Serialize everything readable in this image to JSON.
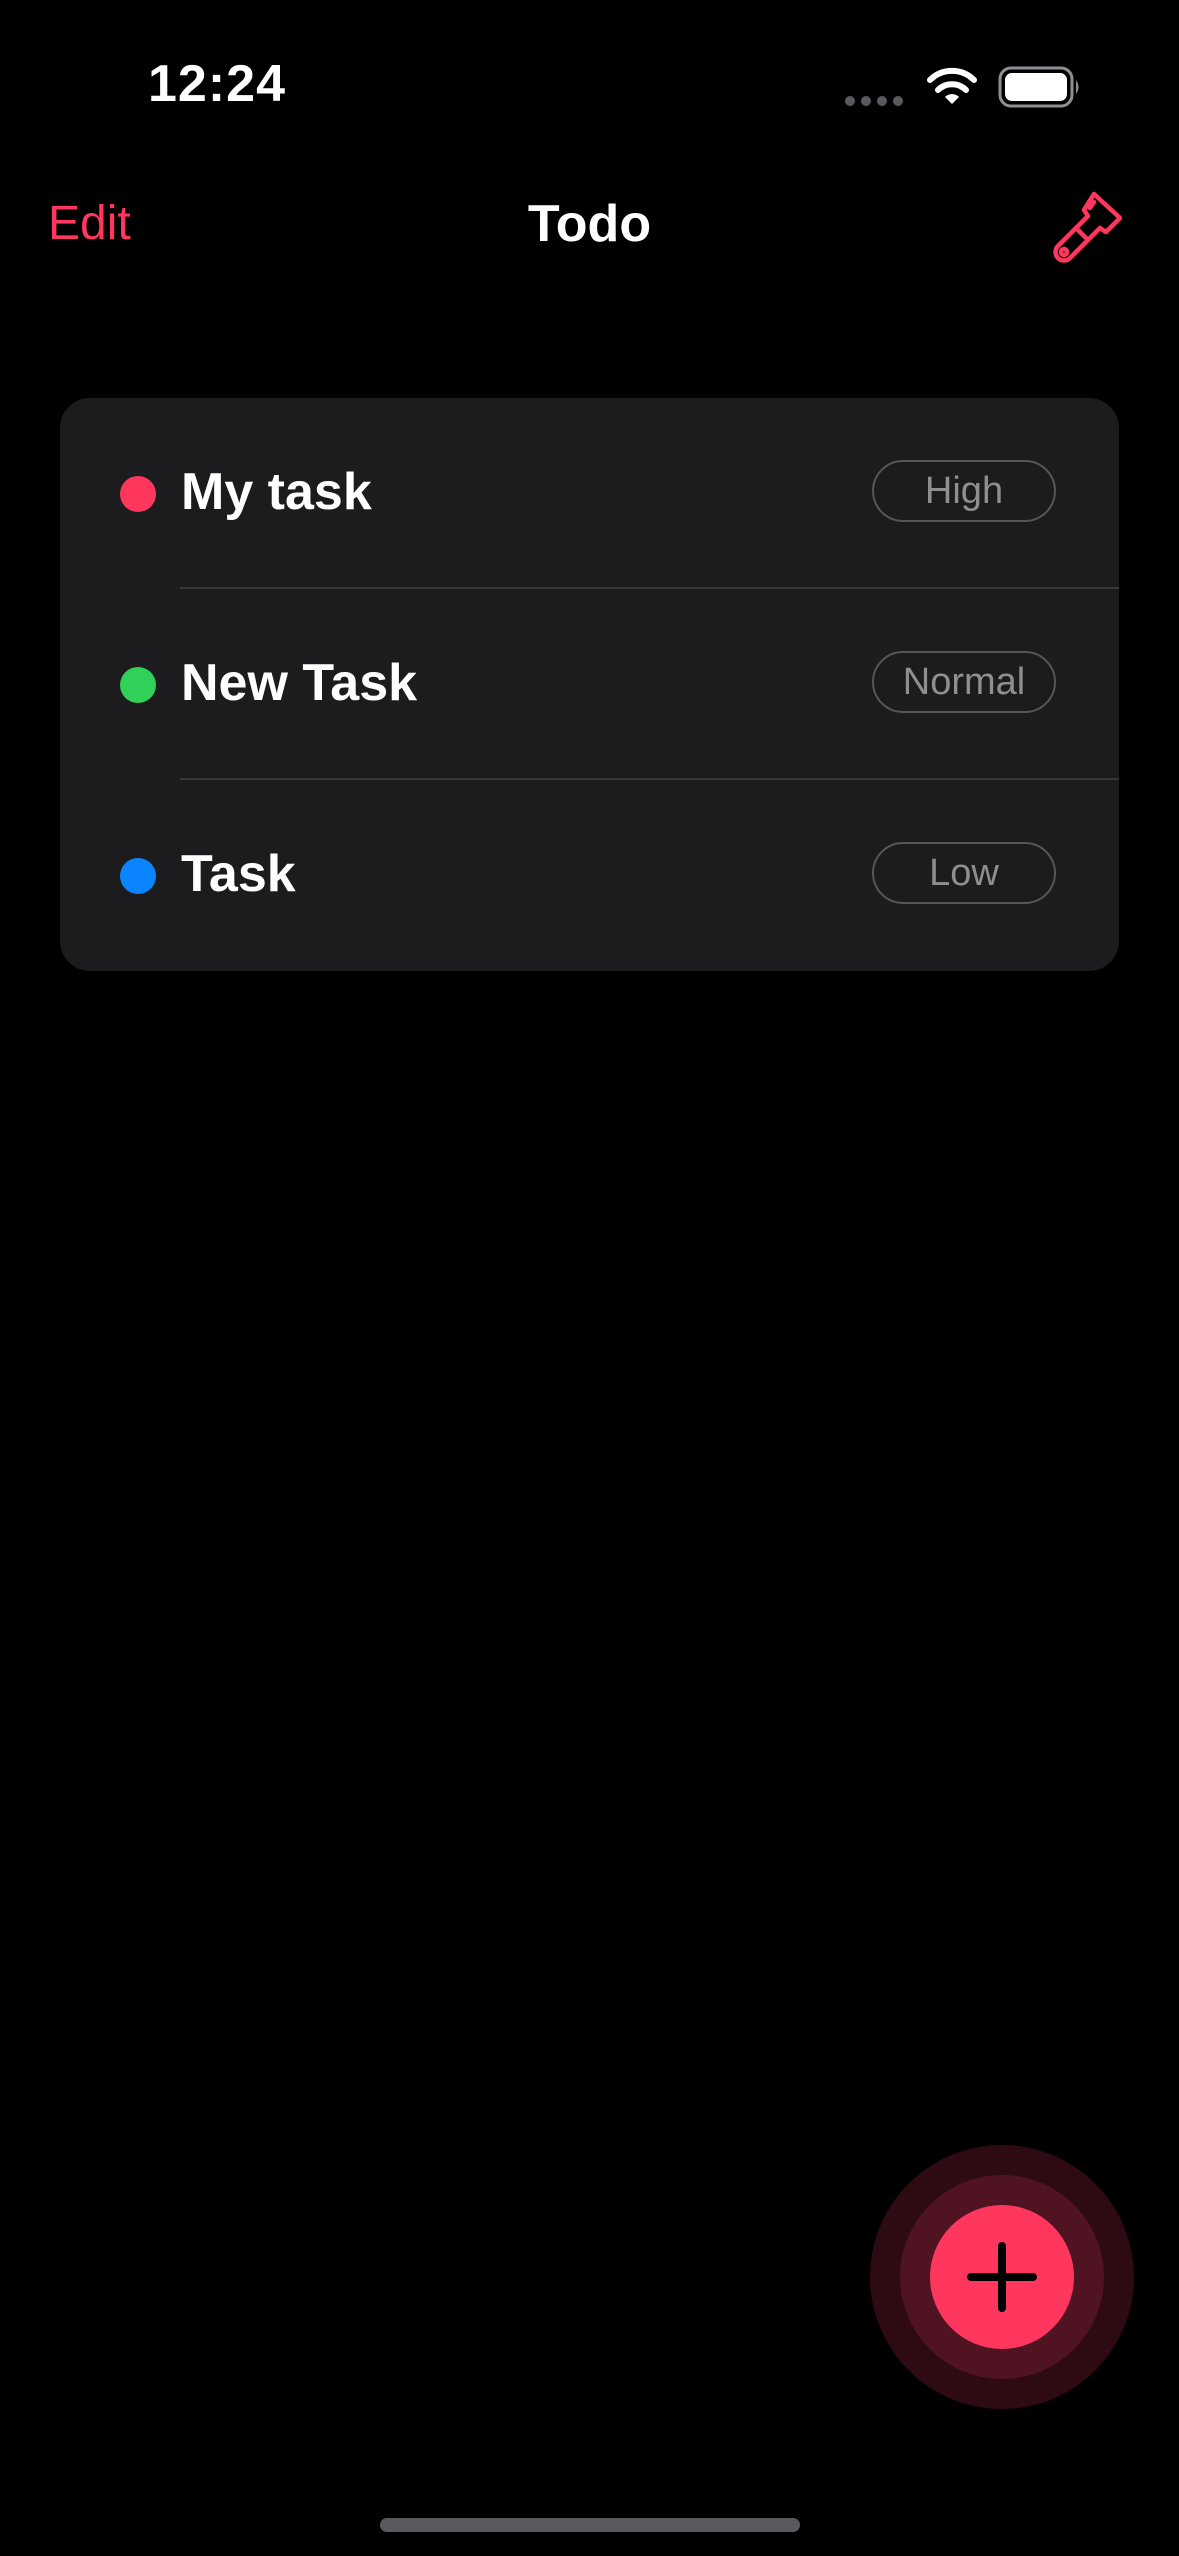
{
  "status_bar": {
    "time": "12:24"
  },
  "nav": {
    "edit_label": "Edit",
    "title": "Todo",
    "right_icon": "paintbrush-icon"
  },
  "tasks": [
    {
      "title": "My task",
      "priority": "High",
      "color": "#ff375f"
    },
    {
      "title": "New Task",
      "priority": "Normal",
      "color": "#30d158"
    },
    {
      "title": "Task",
      "priority": "Low",
      "color": "#0a84ff"
    }
  ],
  "fab": {
    "icon": "plus-icon",
    "color": "#ff375f"
  },
  "colors": {
    "accent": "#ff375f",
    "background": "#000000",
    "card": "#1c1c1e"
  }
}
